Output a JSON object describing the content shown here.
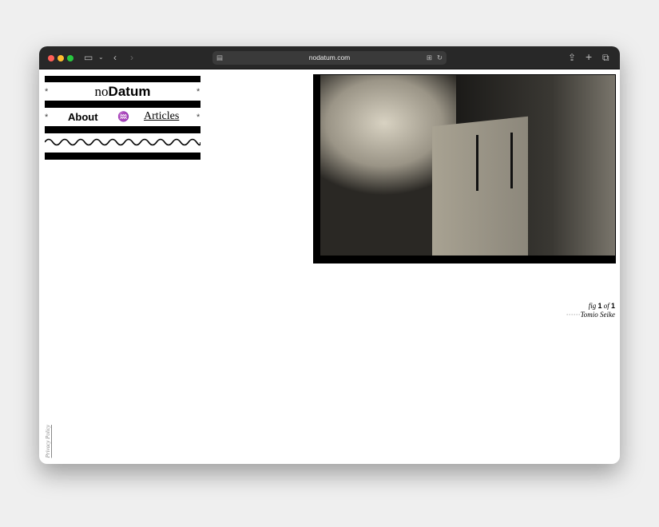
{
  "browser": {
    "url": "nodatum.com"
  },
  "site": {
    "logo_prefix": "no",
    "logo_suffix": "Datum",
    "nav": {
      "about": "About",
      "separator": "♒",
      "articles": "Articles"
    },
    "star": "*"
  },
  "figure": {
    "fig_label": "fig",
    "index": "1",
    "of_label": "of",
    "total": "1",
    "credit_dots": "······",
    "credit": "Tomio Seike"
  },
  "footer": {
    "privacy": "Privacy Policy"
  }
}
